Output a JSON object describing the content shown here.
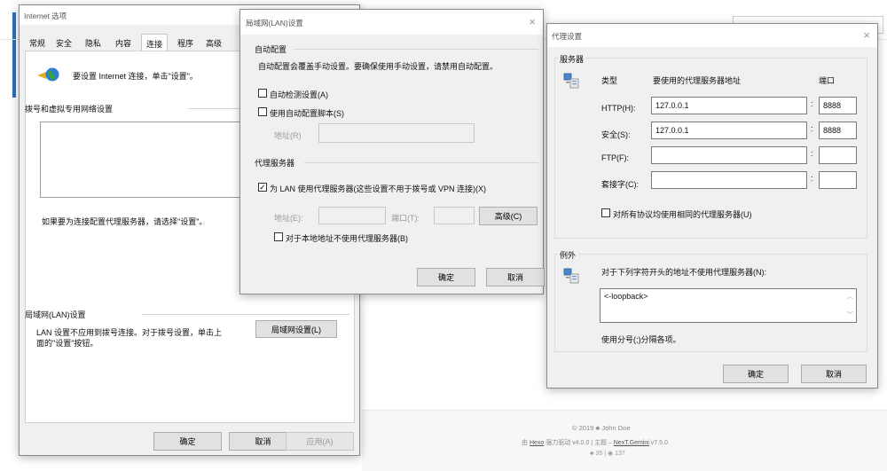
{
  "browser": {
    "footer_line1": "© 2019 ♣ John Doe",
    "footer_line2_prefix": "由 ",
    "footer_hexo": "Hexo",
    "footer_line2_mid": " 强力驱动 v4.0.0  |  主题 – ",
    "footer_theme": "NexT.Gemini",
    "footer_line2_suffix": " v7.5.0",
    "footer_line3": "♣ 35  |  ◉ 137"
  },
  "inet": {
    "title": "Internet 选项",
    "tabs": [
      "常规",
      "安全",
      "隐私",
      "内容",
      "连接",
      "程序",
      "高级"
    ],
    "active_tab": "连接",
    "setup_text": "要设置 Internet 连接，单击\"设置\"。",
    "dialup_heading": "拨号和虚拟专用网络设置",
    "proxy_hint": "如果要为连接配置代理服务器，请选择\"设置\"。",
    "lan_heading": "局域网(LAN)设置",
    "lan_desc_line1": "LAN 设置不应用到拨号连接。对于拨号设置，单击上",
    "lan_desc_line2": "面的\"设置\"按钮。",
    "lan_button": "局域网设置(L)",
    "ok": "确定",
    "cancel": "取消",
    "apply": "应用(A)"
  },
  "lan": {
    "title": "局域网(LAN)设置",
    "auto_heading": "自动配置",
    "auto_desc": "自动配置会覆盖手动设置。要确保使用手动设置，请禁用自动配置。",
    "auto_detect": "自动检测设置(A)",
    "use_script": "使用自动配置脚本(S)",
    "address_label": "地址(R)",
    "proxy_heading": "代理服务器",
    "use_proxy": "为 LAN 使用代理服务器(这些设置不用于拨号或 VPN 连接)(X)",
    "addr_e": "地址(E):",
    "port_t": "端口(T):",
    "advanced": "高级(C)",
    "bypass_local": "对于本地地址不使用代理服务器(B)",
    "ok": "确定",
    "cancel": "取消"
  },
  "proxy": {
    "title": "代理设置",
    "servers_heading": "服务器",
    "col_type": "类型",
    "col_address": "要使用的代理服务器地址",
    "col_port": "端口",
    "rows": [
      {
        "label": "HTTP(H):",
        "address": "127.0.0.1",
        "port": "8888"
      },
      {
        "label": "安全(S):",
        "address": "127.0.0.1",
        "port": "8888"
      },
      {
        "label": "FTP(F):",
        "address": "",
        "port": ""
      },
      {
        "label": "套接字(C):",
        "address": "",
        "port": ""
      }
    ],
    "colon": ":",
    "same_proxy": "对所有协议均使用相同的代理服务器(U)",
    "exceptions_heading": "例外",
    "exceptions_desc": "对于下列字符开头的地址不使用代理服务器(N):",
    "exceptions_value": "<-loopback>",
    "separator_hint": "使用分号(;)分隔各项。",
    "ok": "确定",
    "cancel": "取消"
  },
  "colors": {
    "accent": "#0078d7",
    "window_bg": "#f0f0f0",
    "globe_blue": "#2a7fd4",
    "globe_green": "#3aa33a"
  }
}
